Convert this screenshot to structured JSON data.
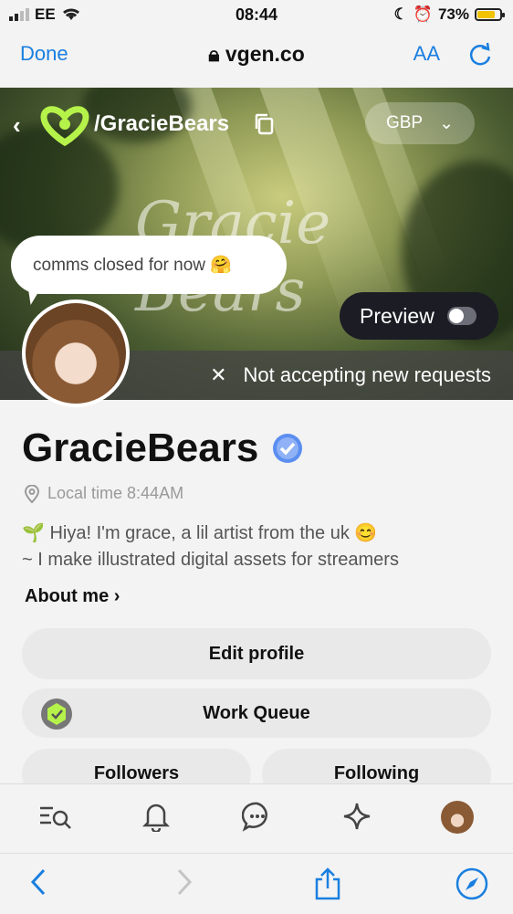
{
  "status_bar": {
    "carrier": "EE",
    "time": "08:44",
    "battery": "73%",
    "battery_level": 0.73
  },
  "browser": {
    "done_label": "Done",
    "url": "vgen.co",
    "text_size_label": "AA"
  },
  "banner": {
    "handle": "/GracieBears",
    "currency": "GBP",
    "script_text": "Gracie Bears",
    "speech_bubble": "comms closed for now 🤗",
    "preview_label": "Preview",
    "preview_on": false,
    "status_text": "Not accepting new requests"
  },
  "profile": {
    "name": "GracieBears",
    "verified": true,
    "local_time": "Local time 8:44AM",
    "bio_line1": "🌱 Hiya! I'm grace, a lil artist from the uk 😊",
    "bio_line2": "~ I make illustrated digital assets for streamers",
    "about_label": "About me",
    "buttons": {
      "edit_profile": "Edit profile",
      "work_queue": "Work Queue",
      "followers": "Followers",
      "following": "Following"
    }
  },
  "colors": {
    "accent_blue": "#1a7fe0",
    "brand_green": "#b6f34a",
    "dark_pill": "#1b1c24",
    "verified_blue": "#5b8ef0"
  },
  "bottom_nav": [
    "list-search-icon",
    "bell-icon",
    "chat-icon",
    "sparkle-icon",
    "avatar"
  ],
  "safari_toolbar": [
    "back-icon",
    "forward-icon",
    "share-icon",
    "compass-icon"
  ]
}
